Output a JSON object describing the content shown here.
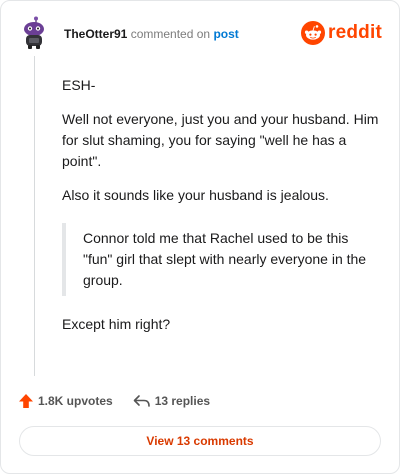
{
  "header": {
    "username": "TheOtter91",
    "verb": "commented on",
    "target": "post"
  },
  "logo": {
    "icon": "reddit-snoo-icon",
    "text": "reddit",
    "color": "#ff4500"
  },
  "comment": {
    "p1": "ESH-",
    "p2": "Well not everyone, just you and your husband. Him for slut shaming, you for saying \"well he has a point\".",
    "p3": "Also it sounds like your husband is jealous.",
    "quote": "Connor told me that Rachel used to be this \"fun\" girl that slept with nearly everyone in the group.",
    "p4": "Except him right?"
  },
  "footer": {
    "upvotes": "1.8K upvotes",
    "upvote_icon": "upvote-arrow-icon",
    "replies": "13 replies",
    "reply_icon": "reply-arrow-icon"
  },
  "view_button": {
    "label": "View 13 comments"
  },
  "colors": {
    "accent": "#ff4500",
    "link": "#0079d3",
    "button_text": "#d93a00"
  }
}
